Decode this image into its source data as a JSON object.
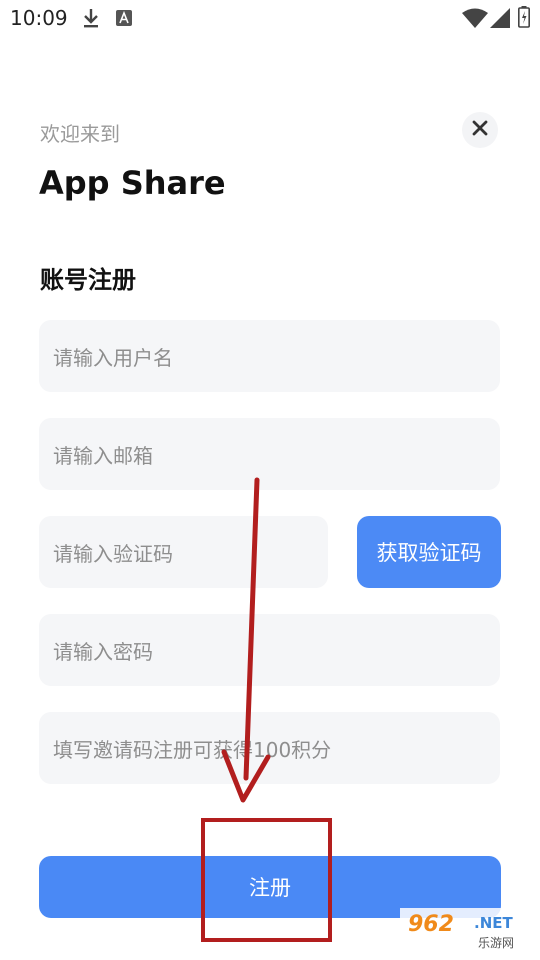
{
  "status_bar": {
    "time": "10:09"
  },
  "header": {
    "welcome": "欢迎来到",
    "app_title": "App Share"
  },
  "form": {
    "title": "账号注册",
    "username_placeholder": "请输入用户名",
    "email_placeholder": "请输入邮箱",
    "code_placeholder": "请输入验证码",
    "get_code_label": "获取验证码",
    "password_placeholder": "请输入密码",
    "invite_placeholder": "填写邀请码注册可获得100积分",
    "register_label": "注册"
  },
  "colors": {
    "primary": "#4a89f5",
    "annotation": "#b21e1e",
    "field_bg": "#f5f6f8"
  },
  "watermark": {
    "brand": "962",
    "domain": ".NET",
    "subtitle": "乐游网"
  }
}
